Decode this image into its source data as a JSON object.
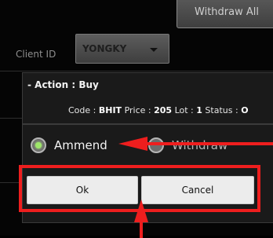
{
  "background": {
    "top_button_label": "Withdraw All",
    "client_label": "Client ID",
    "client_value": "YONGKY"
  },
  "dialog": {
    "title": "- Action : Buy",
    "info": {
      "code_label": "Code :",
      "code_value": "BHIT",
      "price_label": "Price :",
      "price_value": "205",
      "lot_label": "Lot :",
      "lot_value": "1",
      "status_label": "Status :",
      "status_value": "O"
    },
    "options": [
      {
        "label": "Ammend",
        "checked": true
      },
      {
        "label": "Withdraw",
        "checked": false
      }
    ],
    "ok_label": "Ok",
    "cancel_label": "Cancel"
  },
  "colors": {
    "highlight": "#ee1e1e",
    "radio_checked": "#9ee66a"
  }
}
